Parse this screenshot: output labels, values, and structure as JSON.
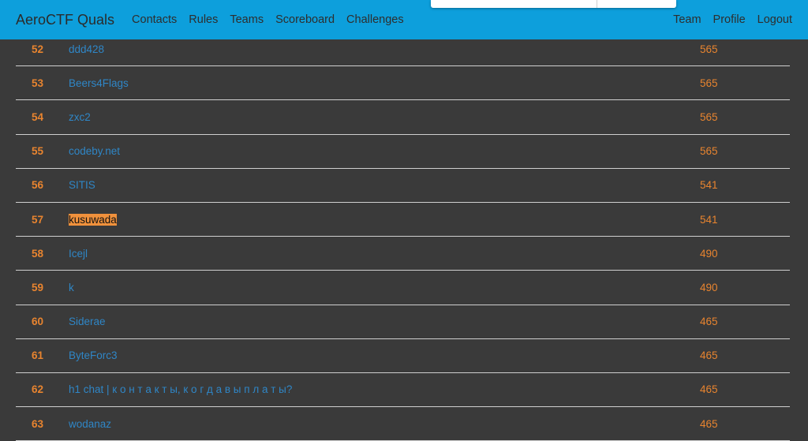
{
  "navbar": {
    "brand": "AeroCTF Quals",
    "left_links": [
      "Contacts",
      "Rules",
      "Teams",
      "Scoreboard",
      "Challenges"
    ],
    "right_links": [
      "Team",
      "Profile",
      "Logout"
    ],
    "color": "#0d9fdc"
  },
  "scoreboard": {
    "rows": [
      {
        "rank": "52",
        "team": "ddd428",
        "score": "565"
      },
      {
        "rank": "53",
        "team": "Beers4Flags",
        "score": "565"
      },
      {
        "rank": "54",
        "team": "zxc2",
        "score": "565"
      },
      {
        "rank": "55",
        "team": "codeby.net",
        "score": "565"
      },
      {
        "rank": "56",
        "team": "SITIS",
        "score": "541"
      },
      {
        "rank": "57",
        "team": "kusuwada",
        "score": "541",
        "highlight": true
      },
      {
        "rank": "58",
        "team": "Icejl",
        "score": "490"
      },
      {
        "rank": "59",
        "team": "k",
        "score": "490"
      },
      {
        "rank": "60",
        "team": "Siderae",
        "score": "465"
      },
      {
        "rank": "61",
        "team": "ByteForc3",
        "score": "465"
      },
      {
        "rank": "62",
        "team": "h1 chat | к о н т а к т ы, к о г д а  в ы п л а т ы?",
        "score": "465"
      },
      {
        "rank": "63",
        "team": "wodanaz",
        "score": "465"
      }
    ]
  }
}
